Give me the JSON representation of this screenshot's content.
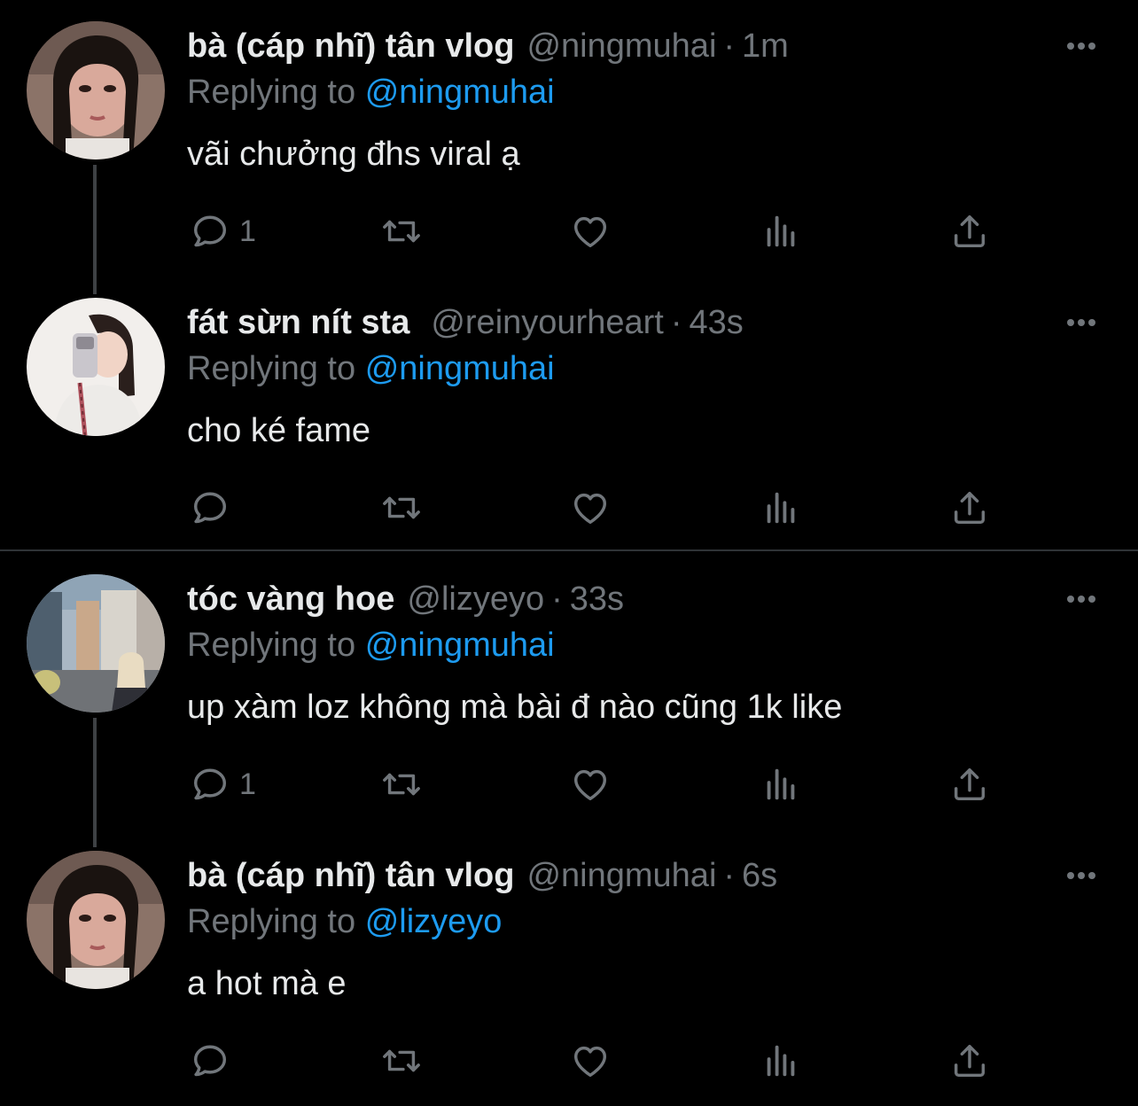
{
  "colors": {
    "background": "#000000",
    "primary_text": "#E7E9EA",
    "secondary_text": "#71767B",
    "link": "#1D9BF0",
    "divider": "#2F3336",
    "thread_line": "#3E4144"
  },
  "icons": {
    "reply": "reply-icon",
    "retweet": "retweet-icon",
    "like": "heart-icon",
    "views": "analytics-icon",
    "share": "share-icon",
    "more": "more-options-icon"
  },
  "tweets": [
    {
      "name": "bà (cáp nhĩ) tân vlog",
      "handle": "@ningmuhai",
      "separator": "·",
      "time": "1m",
      "replying_label": "Replying to",
      "replying_to": "@ningmuhai",
      "text": "vãi chưởng đhs viral ạ",
      "reply_count": "1"
    },
    {
      "name": "fát sừn nít sta",
      "handle": "@reinyourheart",
      "separator": "·",
      "time": "43s",
      "replying_label": "Replying to",
      "replying_to": "@ningmuhai",
      "text": "cho ké fame",
      "reply_count": ""
    },
    {
      "name": "tóc vàng hoe",
      "handle": "@lizyeyo",
      "separator": "·",
      "time": "33s",
      "replying_label": "Replying to",
      "replying_to": "@ningmuhai",
      "text": "up xàm loz không mà bài đ nào cũng 1k like",
      "reply_count": "1"
    },
    {
      "name": "bà (cáp nhĩ) tân vlog",
      "handle": "@ningmuhai",
      "separator": "·",
      "time": "6s",
      "replying_label": "Replying to",
      "replying_to": "@lizyeyo",
      "text": "a hot mà e",
      "reply_count": ""
    }
  ]
}
